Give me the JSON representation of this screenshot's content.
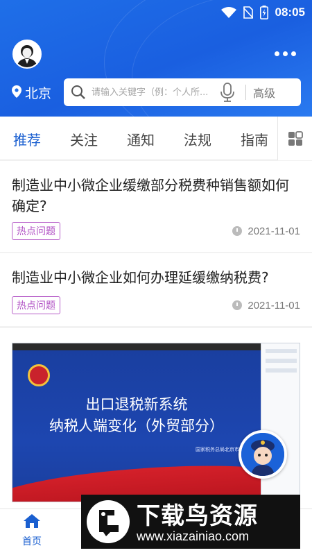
{
  "status_bar": {
    "time": "08:05"
  },
  "header": {
    "location": "北京",
    "search_placeholder": "请输入关键字（例：个人所...",
    "advanced_label": "高级"
  },
  "tabs": [
    {
      "label": "推荐",
      "active": true
    },
    {
      "label": "关注"
    },
    {
      "label": "通知"
    },
    {
      "label": "法规"
    },
    {
      "label": "指南"
    }
  ],
  "articles": [
    {
      "title": "制造业中小微企业缓缴部分税费种销售额如何确定?",
      "tag": "热点问题",
      "date": "2021-11-01"
    },
    {
      "title": "制造业中小微企业如何办理延缓缴纳税费?",
      "tag": "热点问题",
      "date": "2021-11-01"
    }
  ],
  "video": {
    "slide_title_line1": "出口退税新系统",
    "slide_title_line2": "纳税人端变化（外贸部分）",
    "slide_org": "国家税务总局北京市税务局"
  },
  "bottom_nav": {
    "home_label": "首页"
  },
  "watermark": {
    "title": "下载鸟资源",
    "url": "www.xiazainiao.com"
  },
  "colors": {
    "brand_blue": "#1a5fe0",
    "tag_purple": "#b04fc4",
    "active_tab": "#1a5fd0"
  },
  "icons": [
    "wifi-icon",
    "no-sim-icon",
    "battery-charging-icon",
    "avatar",
    "more-icon",
    "location-pin-icon",
    "search-icon",
    "microphone-icon",
    "grid-icon",
    "clock-icon",
    "home-icon"
  ]
}
